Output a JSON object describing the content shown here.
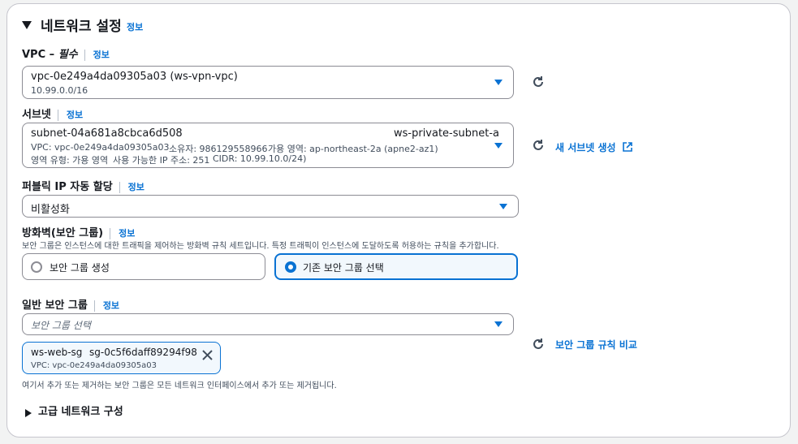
{
  "section": {
    "title": "네트워크 설정",
    "info": "정보"
  },
  "vpc": {
    "label": "VPC – ",
    "label_required": "필수",
    "info": "정보",
    "value": "vpc-0e249a4da09305a03 (ws-vpn-vpc)",
    "cidr": "10.99.0.0/16"
  },
  "subnet": {
    "label": "서브넷",
    "info": "정보",
    "id": "subnet-04a681a8cbca6d508",
    "name": "ws-private-subnet-a",
    "line1": {
      "vpc": "VPC: vpc-0e249a4da09305a03",
      "owner": "소유자: 986129558966",
      "az": "가용 영역: ap-northeast-2a (apne2-az1)"
    },
    "line2": {
      "zone_type": "영역 유형: 가용 영역",
      "available_ips": "사용 가능한 IP 주소: 251",
      "cidr": "CIDR: 10.99.10.0/24)"
    },
    "create_link": "새 서브넷 생성"
  },
  "public_ip": {
    "label": "퍼블릭 IP 자동 할당",
    "info": "정보",
    "value": "비활성화"
  },
  "firewall": {
    "label": "방화벽(보안 그룹)",
    "info": "정보",
    "description": "보안 그룹은 인스턴스에 대한 트래픽을 제어하는 방화벽 규칙 세트입니다. 특정 트래픽이 인스턴스에 도달하도록 허용하는 규칙을 추가합니다.",
    "option_create": "보안 그룹 생성",
    "option_existing": "기존 보안 그룹 선택",
    "selected": "option_existing"
  },
  "security_group": {
    "label": "일반 보안 그룹",
    "info": "정보",
    "placeholder": "보안 그룹 선택",
    "compare_link": "보안 그룹 규칙 비교",
    "token": {
      "name": "ws-web-sg",
      "id": "sg-0c5f6daff89294f98",
      "vpc": "VPC: vpc-0e249a4da09305a03"
    },
    "note": "여기서 추가 또는 제거하는 보안 그룹은 모든 네트워크 인터페이스에서 추가 또는 제거됩니다."
  },
  "advanced": {
    "title": "고급 네트워크 구성"
  },
  "colors": {
    "accent": "#0972d3",
    "border": "#8c8c94",
    "text": "#16191f",
    "muted": "#414d5c"
  }
}
